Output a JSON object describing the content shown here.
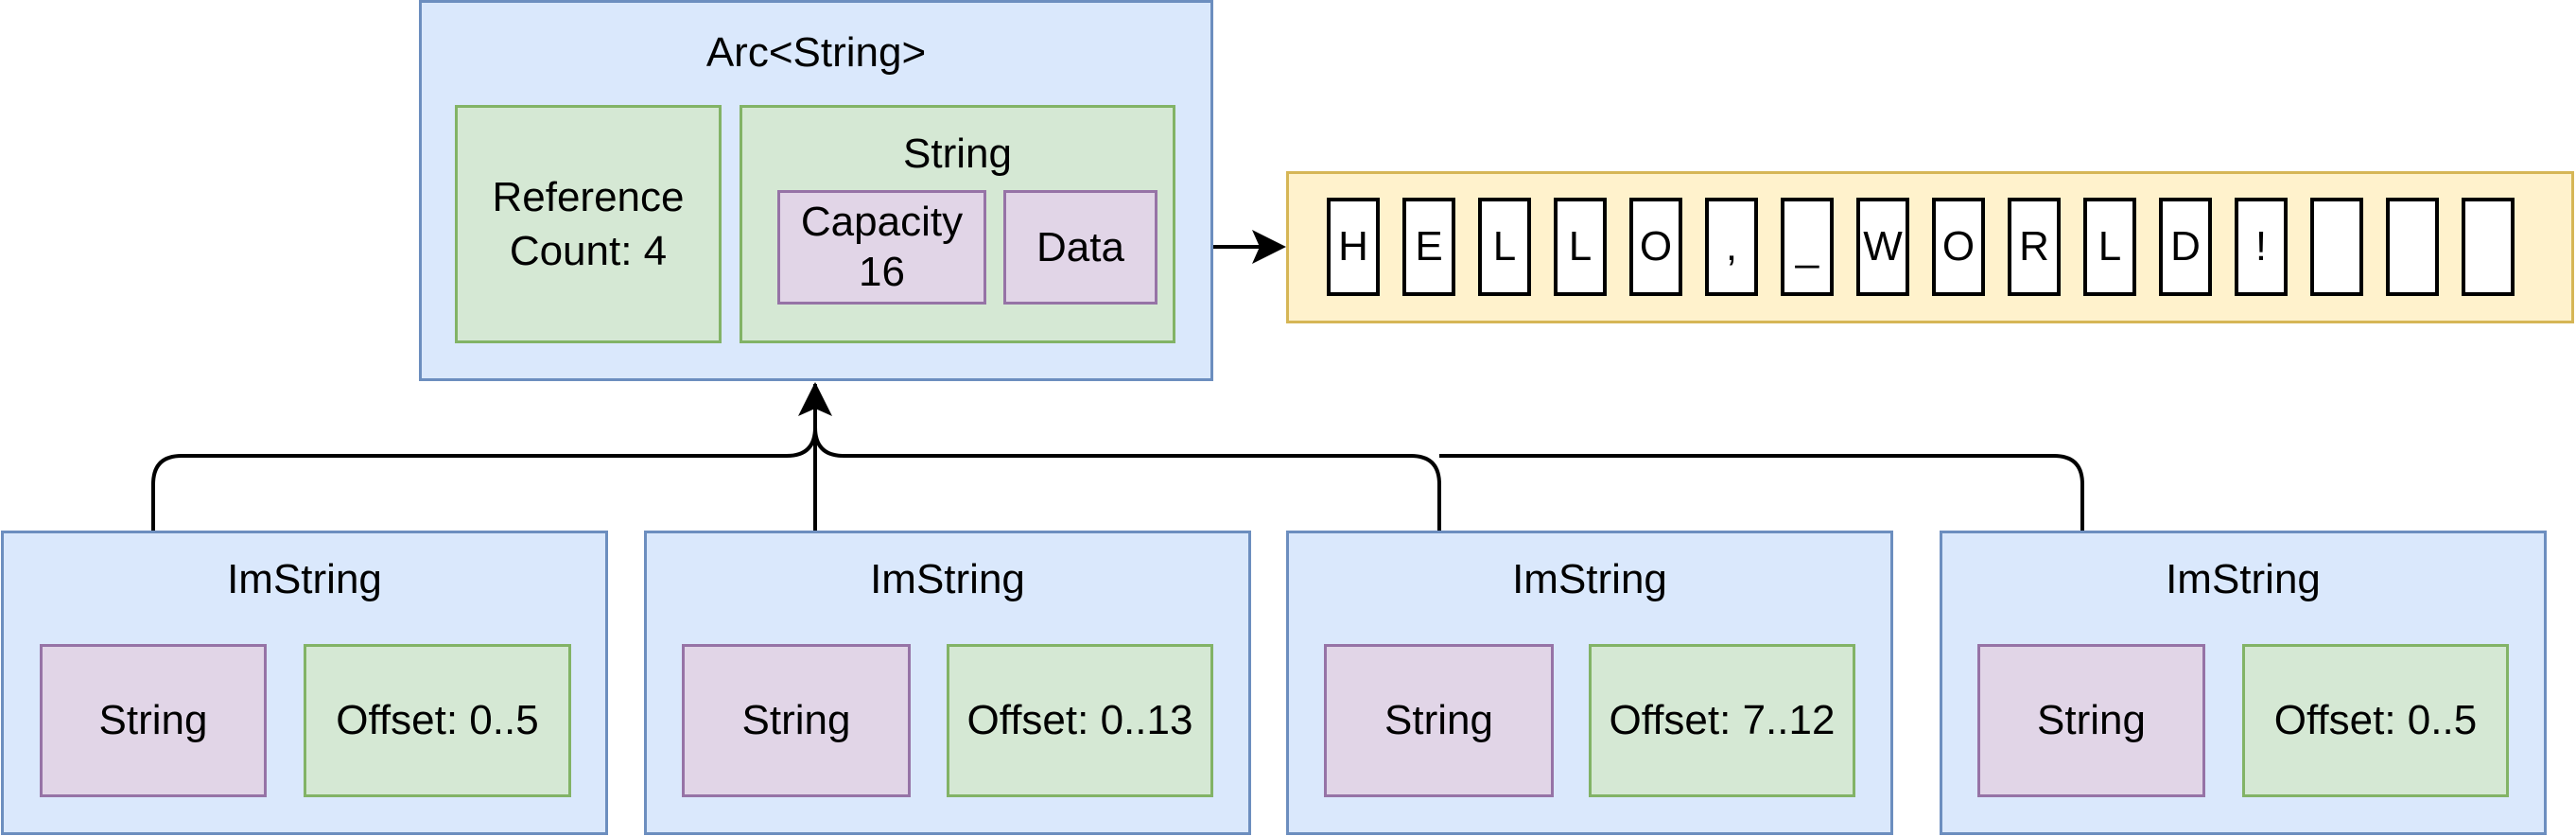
{
  "arc": {
    "title": "Arc<String>",
    "reference_count": "Reference\nCount: 4",
    "string": {
      "title": "String",
      "capacity": "Capacity\n16",
      "data": "Data"
    }
  },
  "buffer": {
    "cells": [
      "H",
      "E",
      "L",
      "L",
      "O",
      ",",
      "_",
      "W",
      "O",
      "R",
      "L",
      "D",
      "!",
      "",
      "",
      ""
    ]
  },
  "imstrings": [
    {
      "title": "ImString",
      "string": "String",
      "offset": "Offset: 0..5"
    },
    {
      "title": "ImString",
      "string": "String",
      "offset": "Offset: 0..13"
    },
    {
      "title": "ImString",
      "string": "String",
      "offset": "Offset: 7..12"
    },
    {
      "title": "ImString",
      "string": "String",
      "offset": "Offset: 0..5"
    }
  ],
  "colors": {
    "container_fill": "#dae8fc",
    "container_stroke": "#6c8ebf",
    "field_fill": "#d5e8d4",
    "field_stroke": "#82b366",
    "pointer_fill": "#e1d5e7",
    "pointer_stroke": "#9673a6",
    "buffer_fill": "#fff2cc",
    "buffer_stroke": "#d6b656"
  }
}
